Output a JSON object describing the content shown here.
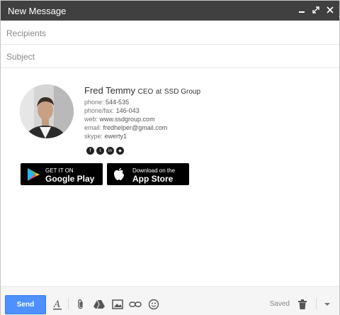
{
  "window": {
    "title": "New Message"
  },
  "compose": {
    "recipients_placeholder": "Recipients",
    "subject_placeholder": "Subject"
  },
  "signature": {
    "name": "Fred Temmy",
    "title": "CEO",
    "company_prefix": "at",
    "company": "SSD Group",
    "phone_label": "phone:",
    "phone": "544-535",
    "fax_label": "phone/fax:",
    "fax": "146-043",
    "web_label": "web:",
    "web": "www.ssdgroup.com",
    "email_label": "email:",
    "email": "fredhelper@gmail.com",
    "skype_label": "skype:",
    "skype": "ewerty1",
    "social_icons": [
      "facebook-icon",
      "twitter-icon",
      "linkedin-icon",
      "other-icon"
    ],
    "google_play": {
      "small": "GET IT ON",
      "big": "Google Play"
    },
    "app_store": {
      "small": "Download on the",
      "big": "App Store"
    }
  },
  "toolbar": {
    "send_label": "Send",
    "saved_label": "Saved",
    "accent": "#4d90fe",
    "titlebar_color": "#404040"
  }
}
